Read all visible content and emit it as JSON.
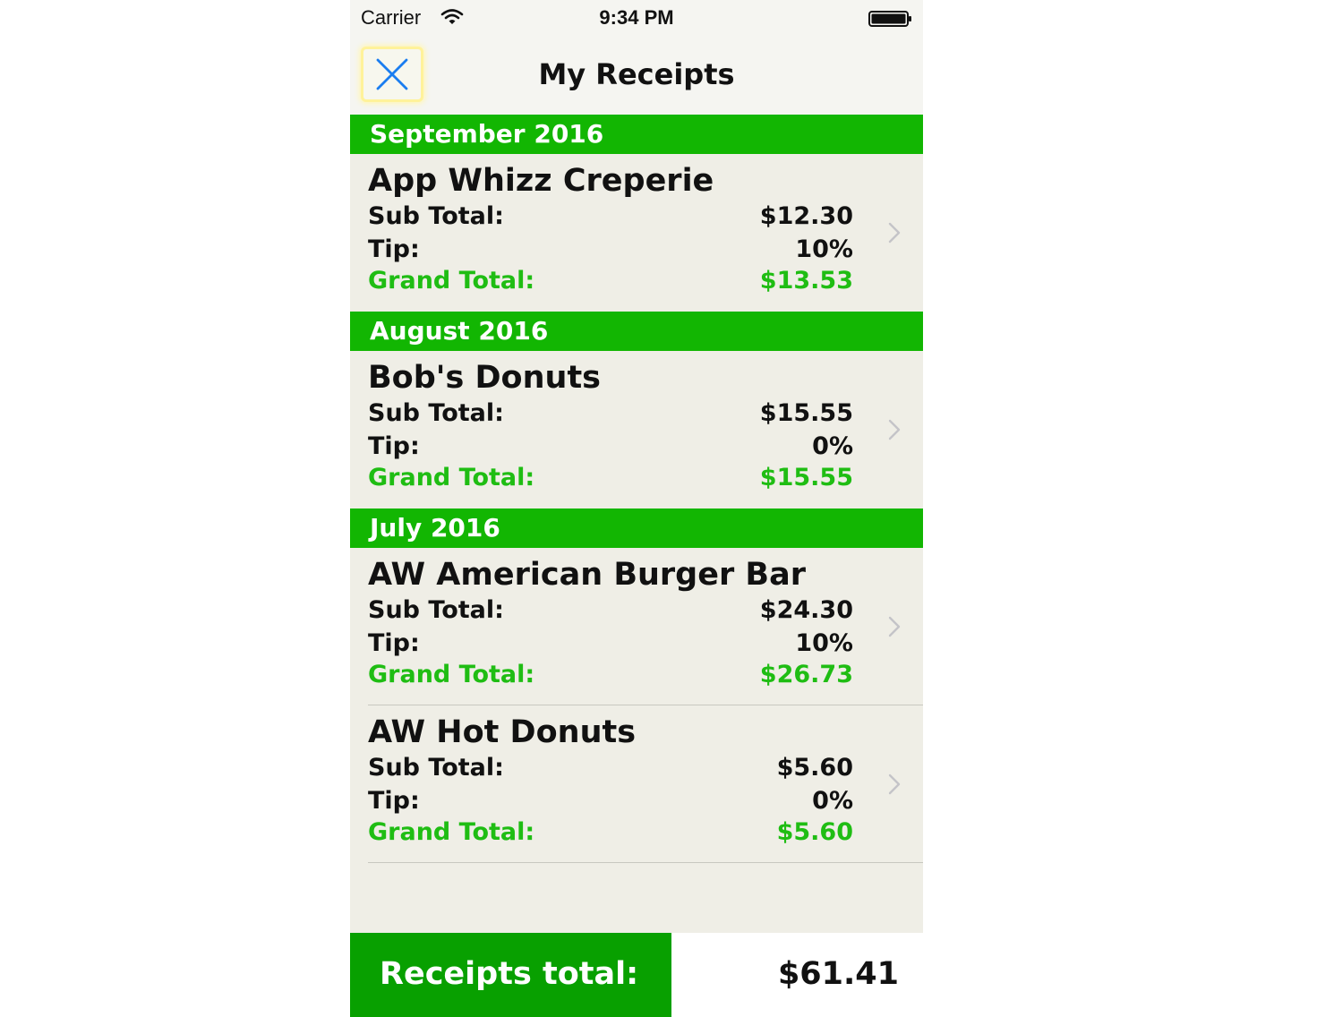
{
  "status_bar": {
    "carrier": "Carrier",
    "time": "9:34 PM"
  },
  "nav": {
    "title": "My Receipts",
    "close_icon": "close-x-icon"
  },
  "colors": {
    "section_green": "#12b602",
    "grand_total_green": "#1fbd13",
    "footer_green": "#08a000",
    "close_blue": "#1a7df0"
  },
  "sections": [
    {
      "header": "September 2016",
      "receipts": [
        {
          "name": "App Whizz Creperie",
          "sub_total_label": "Sub Total:",
          "sub_total": "$12.30",
          "tip_label": "Tip:",
          "tip": "10%",
          "grand_total_label": "Grand Total:",
          "grand_total": "$13.53"
        }
      ]
    },
    {
      "header": "August 2016",
      "receipts": [
        {
          "name": "Bob's Donuts",
          "sub_total_label": "Sub Total:",
          "sub_total": "$15.55",
          "tip_label": "Tip:",
          "tip": "0%",
          "grand_total_label": "Grand Total:",
          "grand_total": "$15.55"
        }
      ]
    },
    {
      "header": "July 2016",
      "receipts": [
        {
          "name": "AW American Burger Bar",
          "sub_total_label": "Sub Total:",
          "sub_total": "$24.30",
          "tip_label": "Tip:",
          "tip": "10%",
          "grand_total_label": "Grand Total:",
          "grand_total": "$26.73"
        },
        {
          "name": "AW Hot Donuts",
          "sub_total_label": "Sub Total:",
          "sub_total": "$5.60",
          "tip_label": "Tip:",
          "tip": "0%",
          "grand_total_label": "Grand Total:",
          "grand_total": "$5.60"
        }
      ]
    }
  ],
  "footer": {
    "label": "Receipts total:",
    "value": "$61.41"
  }
}
